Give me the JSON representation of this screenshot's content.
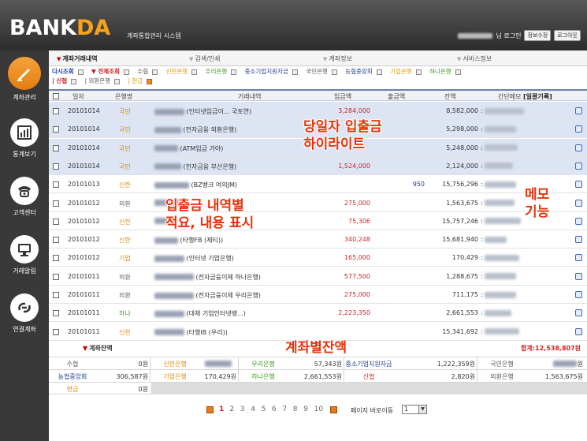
{
  "header": {
    "logo_prefix": "BANK",
    "logo_accent": "DA",
    "subtitle": "계좌통합관리 시스템",
    "greeting": "님 로그인",
    "btn_profile": "정보수정",
    "btn_logout": "로그아웃"
  },
  "sidebar": {
    "items": [
      {
        "label": "계좌관리",
        "icon": "pen-icon"
      },
      {
        "label": "통계보기",
        "icon": "bar-chart-icon"
      },
      {
        "label": "고객센터",
        "icon": "telephone-icon"
      },
      {
        "label": "거래알림",
        "icon": "monitor-icon"
      },
      {
        "label": "연결계좌",
        "icon": "link-icon"
      }
    ]
  },
  "tabs": [
    {
      "label": "계좌거래내역"
    },
    {
      "label": "검색/인쇄"
    },
    {
      "label": "계좌정보"
    },
    {
      "label": "서비스정보"
    }
  ],
  "filters": {
    "row1": [
      "다시조회",
      "전체조회",
      "수협",
      "신한은행",
      "우리은행",
      "중소기업지원자금",
      "국민은행",
      "농협중앙회",
      "기업은행",
      "하나은행"
    ],
    "row2": [
      "신협",
      "외환은행",
      "현금"
    ]
  },
  "table": {
    "headers": {
      "date": "일자",
      "bank": "은행명",
      "desc": "거래내역",
      "in": "입금액",
      "out": "출금액",
      "balance": "잔액",
      "memo": "간단메모",
      "memo_bracket": "[일괄기록]"
    },
    "rows": [
      {
        "date": "20101014",
        "bank": "국민",
        "desc": "(인터넷입금이... 국토연)",
        "in": "3,284,000",
        "out": "",
        "balance": "8,582,000",
        "hl": true
      },
      {
        "date": "20101014",
        "bank": "국민",
        "desc": "(전자금융 외환은행)",
        "in": "",
        "out": "",
        "balance": "5,298,000",
        "hl": true
      },
      {
        "date": "20101014",
        "bank": "국민",
        "desc": "(ATM입금 가야)",
        "in": "",
        "out": "",
        "balance": "5,248,000",
        "hl": true
      },
      {
        "date": "20101014",
        "bank": "국민",
        "desc": "(전자금융 부산은행)",
        "in": "1,524,000",
        "out": "",
        "balance": "2,124,000",
        "hl": true
      },
      {
        "date": "20101013",
        "bank": "신한",
        "desc": "(BZ뱅크 여의JM)",
        "in": "",
        "out": "950",
        "balance": "15,756,296",
        "hl": false
      },
      {
        "date": "20101012",
        "bank": "외환",
        "desc": "",
        "in": "275,000",
        "out": "",
        "balance": "1,563,675",
        "hl": false
      },
      {
        "date": "20101012",
        "bank": "신한",
        "desc": "",
        "in": "75,306",
        "out": "",
        "balance": "15,757,246",
        "hl": false
      },
      {
        "date": "20101012",
        "bank": "신한",
        "desc": "(타행FB (제티))",
        "in": "340,248",
        "out": "",
        "balance": "15,681,940",
        "hl": false
      },
      {
        "date": "20101012",
        "bank": "기업",
        "desc": "(인터넷 기업은행)",
        "in": "165,000",
        "out": "",
        "balance": "170,429",
        "hl": false
      },
      {
        "date": "20101011",
        "bank": "외환",
        "desc": "(전자금융이체 하나은행)",
        "in": "577,500",
        "out": "",
        "balance": "1,288,675",
        "hl": false
      },
      {
        "date": "20101011",
        "bank": "외환",
        "desc": "(전자금융이체 우리은행)",
        "in": "275,000",
        "out": "",
        "balance": "711,175",
        "hl": false
      },
      {
        "date": "20101011",
        "bank": "하나",
        "desc": "(대체 기업인터넷뱅...)",
        "in": "2,223,350",
        "out": "",
        "balance": "2,661,553",
        "hl": false
      },
      {
        "date": "20101011",
        "bank": "신한",
        "desc": "(타행IB (우리))",
        "in": "",
        "out": "",
        "balance": "15,341,692",
        "hl": false
      }
    ]
  },
  "overlays": {
    "highlight_line1": "당일자 입출금",
    "highlight_line2": "하이라이트",
    "desc_line1": "입출금 내역별",
    "desc_line2": "적요, 내용 표시",
    "memo_line1": "메모",
    "memo_line2": "기능",
    "balance": "계좌별잔액"
  },
  "balances": {
    "title": "계좌잔액",
    "total": "합계:12,538,807원",
    "rows": [
      [
        {
          "name": "수협",
          "value": "0원",
          "color": "gray"
        },
        {
          "name": "신한은행",
          "value": "",
          "color": "orange"
        },
        {
          "name": "우리은행",
          "value": "57,343원",
          "color": "green"
        },
        {
          "name": "중소기업지원자금",
          "value": "1,222,359원",
          "color": "blue"
        },
        {
          "name": "국민은행",
          "value": "원",
          "color": "gray"
        }
      ],
      [
        {
          "name": "농협중앙회",
          "value": "306,587원",
          "color": "blue"
        },
        {
          "name": "기업은행",
          "value": "170,429원",
          "color": "orange"
        },
        {
          "name": "하나은행",
          "value": "2,661,553원",
          "color": "green"
        },
        {
          "name": "신협",
          "value": "2,820원",
          "color": "red"
        },
        {
          "name": "외환은행",
          "value": "1,563,675원",
          "color": "gray"
        }
      ],
      [
        {
          "name": "현금",
          "value": "0원",
          "color": "orange"
        }
      ]
    ]
  },
  "pager": {
    "pages": [
      "1",
      "2",
      "3",
      "4",
      "5",
      "6",
      "7",
      "8",
      "9",
      "10"
    ],
    "current": "1",
    "jump_label": "페이지 바로이동",
    "jump_value": "1"
  }
}
